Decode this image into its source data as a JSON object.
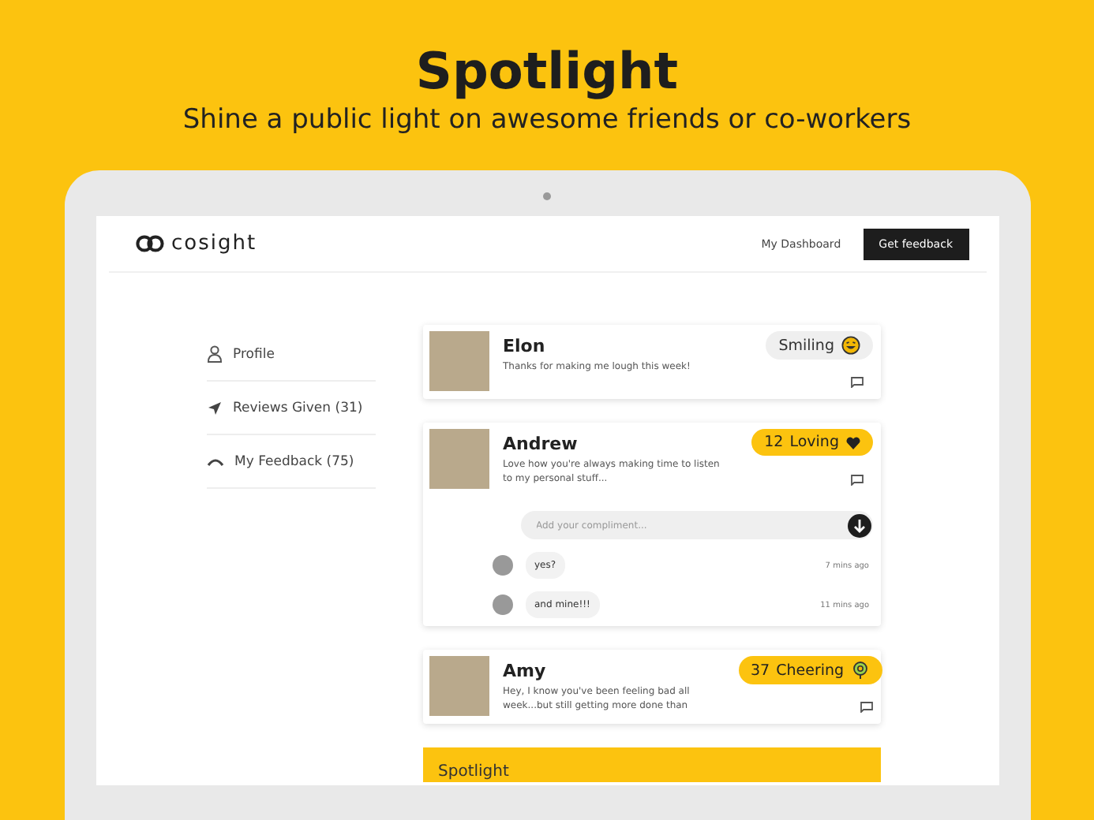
{
  "hero": {
    "title": "Spotlight",
    "subtitle": "Shine a public light on awesome friends or co-workers"
  },
  "app": {
    "logo": "cosight",
    "nav": [
      {
        "label": "My Dashboard",
        "kind": "link"
      },
      {
        "label": "Get feedback",
        "kind": "button"
      }
    ]
  },
  "sidebar": {
    "items": [
      {
        "label": "Profile"
      },
      {
        "label": "Reviews Given (31)"
      },
      {
        "label": "My Feedback (75)"
      }
    ]
  },
  "cards": [
    {
      "name": "Elon",
      "message": "Thanks for making me lough this week!",
      "badge": {
        "label": "Smiling",
        "highlighted": false
      }
    },
    {
      "name": "Andrew",
      "message": "Love how you're always making time to listen to my personal stuff...",
      "badge": {
        "count": "12",
        "label": "Loving",
        "highlighted": true
      },
      "compliment_field": {
        "placeholder": "Add your compliment..."
      },
      "comments": [
        {
          "text": "yes?",
          "time": "7 mins ago"
        },
        {
          "text": "and mine!!!",
          "time": "11 mins ago"
        }
      ]
    },
    {
      "name": "Amy",
      "message": "Hey, I know you've been feeling bad all week...but still getting more done than",
      "badge": {
        "count": "37",
        "label": "Cheering",
        "highlighted": true
      }
    }
  ],
  "spotlight_bar": {
    "title": "Spotlight"
  }
}
